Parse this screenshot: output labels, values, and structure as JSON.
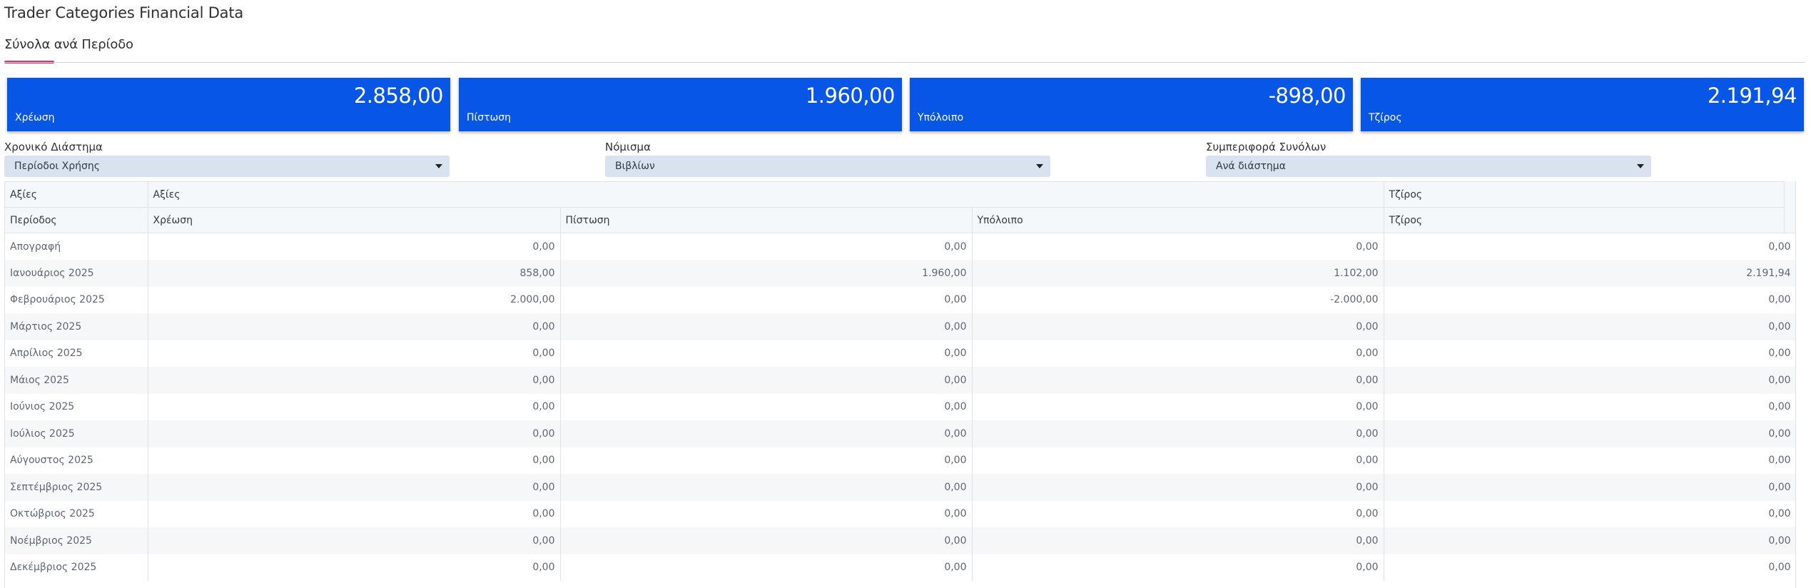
{
  "page": {
    "title": "Trader Categories Financial Data"
  },
  "tabs": [
    {
      "label": "Σύνολα ανά Περίοδο",
      "active": true
    }
  ],
  "accent_color": "#d6336c",
  "kpi_color": "#0756e6",
  "kpis": [
    {
      "label": "Χρέωση",
      "value": "2.858,00"
    },
    {
      "label": "Πίστωση",
      "value": "1.960,00"
    },
    {
      "label": "Υπόλοιπο",
      "value": "-898,00"
    },
    {
      "label": "Τζίρος",
      "value": "2.191,94"
    }
  ],
  "filters": [
    {
      "label": "Χρονικό Διάστημα",
      "value": "Περίοδοι Χρήσης",
      "icon": "chevron-down-icon"
    },
    {
      "label": "Νόμισμα",
      "value": "Βιβλίων",
      "icon": "chevron-down-icon"
    },
    {
      "label": "Συμπεριφορά Συνόλων",
      "value": "Ανά διάστημα",
      "icon": "chevron-down-icon"
    }
  ],
  "grid": {
    "group_headers": [
      "Αξίες",
      "Αξίες",
      "Τζίρος"
    ],
    "columns": [
      "Περίοδος",
      "Χρέωση",
      "Πίστωση",
      "Υπόλοιπο",
      "Τζίρος"
    ],
    "rows": [
      [
        "Απογραφή",
        "0,00",
        "0,00",
        "0,00",
        "0,00"
      ],
      [
        "Ιανουάριος 2025",
        "858,00",
        "1.960,00",
        "1.102,00",
        "2.191,94"
      ],
      [
        "Φεβρουάριος 2025",
        "2.000,00",
        "0,00",
        "-2.000,00",
        "0,00"
      ],
      [
        "Μάρτιος 2025",
        "0,00",
        "0,00",
        "0,00",
        "0,00"
      ],
      [
        "Απρίλιος 2025",
        "0,00",
        "0,00",
        "0,00",
        "0,00"
      ],
      [
        "Μάιος 2025",
        "0,00",
        "0,00",
        "0,00",
        "0,00"
      ],
      [
        "Ιούνιος 2025",
        "0,00",
        "0,00",
        "0,00",
        "0,00"
      ],
      [
        "Ιούλιος 2025",
        "0,00",
        "0,00",
        "0,00",
        "0,00"
      ],
      [
        "Αύγουστος 2025",
        "0,00",
        "0,00",
        "0,00",
        "0,00"
      ],
      [
        "Σεπτέμβριος 2025",
        "0,00",
        "0,00",
        "0,00",
        "0,00"
      ],
      [
        "Οκτώβριος 2025",
        "0,00",
        "0,00",
        "0,00",
        "0,00"
      ],
      [
        "Νοέμβριος 2025",
        "0,00",
        "0,00",
        "0,00",
        "0,00"
      ],
      [
        "Δεκέμβριος 2025",
        "0,00",
        "0,00",
        "0,00",
        "0,00"
      ]
    ]
  }
}
